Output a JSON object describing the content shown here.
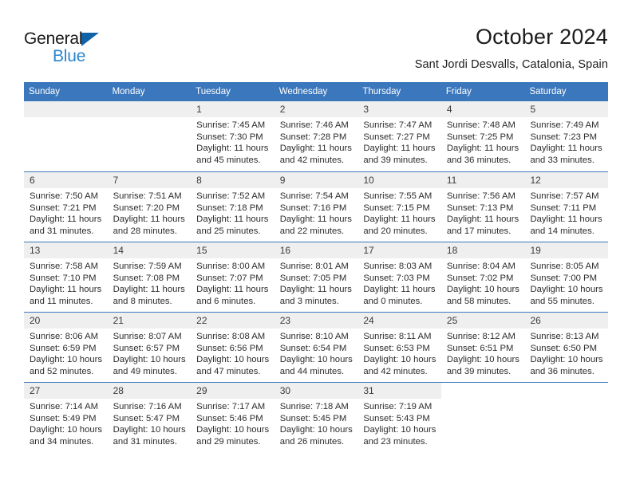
{
  "brand": {
    "name_part1": "General",
    "name_part2": "Blue",
    "triangle_color": "#1063a8",
    "blue_text_color": "#2a87d0"
  },
  "header": {
    "title": "October 2024",
    "location": "Sant Jordi Desvalls, Catalonia, Spain",
    "accent_color": "#3b77bc"
  },
  "weekdays": [
    "Sunday",
    "Monday",
    "Tuesday",
    "Wednesday",
    "Thursday",
    "Friday",
    "Saturday"
  ],
  "weeks": [
    [
      {
        "day": "",
        "state": "blank",
        "lines": []
      },
      {
        "day": "",
        "state": "blank",
        "lines": []
      },
      {
        "day": "1",
        "state": "filled",
        "lines": [
          "Sunrise: 7:45 AM",
          "Sunset: 7:30 PM",
          "Daylight: 11 hours",
          "and 45 minutes."
        ]
      },
      {
        "day": "2",
        "state": "filled",
        "lines": [
          "Sunrise: 7:46 AM",
          "Sunset: 7:28 PM",
          "Daylight: 11 hours",
          "and 42 minutes."
        ]
      },
      {
        "day": "3",
        "state": "filled",
        "lines": [
          "Sunrise: 7:47 AM",
          "Sunset: 7:27 PM",
          "Daylight: 11 hours",
          "and 39 minutes."
        ]
      },
      {
        "day": "4",
        "state": "filled",
        "lines": [
          "Sunrise: 7:48 AM",
          "Sunset: 7:25 PM",
          "Daylight: 11 hours",
          "and 36 minutes."
        ]
      },
      {
        "day": "5",
        "state": "filled",
        "lines": [
          "Sunrise: 7:49 AM",
          "Sunset: 7:23 PM",
          "Daylight: 11 hours",
          "and 33 minutes."
        ]
      }
    ],
    [
      {
        "day": "6",
        "state": "filled",
        "lines": [
          "Sunrise: 7:50 AM",
          "Sunset: 7:21 PM",
          "Daylight: 11 hours",
          "and 31 minutes."
        ]
      },
      {
        "day": "7",
        "state": "filled",
        "lines": [
          "Sunrise: 7:51 AM",
          "Sunset: 7:20 PM",
          "Daylight: 11 hours",
          "and 28 minutes."
        ]
      },
      {
        "day": "8",
        "state": "filled",
        "lines": [
          "Sunrise: 7:52 AM",
          "Sunset: 7:18 PM",
          "Daylight: 11 hours",
          "and 25 minutes."
        ]
      },
      {
        "day": "9",
        "state": "filled",
        "lines": [
          "Sunrise: 7:54 AM",
          "Sunset: 7:16 PM",
          "Daylight: 11 hours",
          "and 22 minutes."
        ]
      },
      {
        "day": "10",
        "state": "filled",
        "lines": [
          "Sunrise: 7:55 AM",
          "Sunset: 7:15 PM",
          "Daylight: 11 hours",
          "and 20 minutes."
        ]
      },
      {
        "day": "11",
        "state": "filled",
        "lines": [
          "Sunrise: 7:56 AM",
          "Sunset: 7:13 PM",
          "Daylight: 11 hours",
          "and 17 minutes."
        ]
      },
      {
        "day": "12",
        "state": "filled",
        "lines": [
          "Sunrise: 7:57 AM",
          "Sunset: 7:11 PM",
          "Daylight: 11 hours",
          "and 14 minutes."
        ]
      }
    ],
    [
      {
        "day": "13",
        "state": "filled",
        "lines": [
          "Sunrise: 7:58 AM",
          "Sunset: 7:10 PM",
          "Daylight: 11 hours",
          "and 11 minutes."
        ]
      },
      {
        "day": "14",
        "state": "filled",
        "lines": [
          "Sunrise: 7:59 AM",
          "Sunset: 7:08 PM",
          "Daylight: 11 hours",
          "and 8 minutes."
        ]
      },
      {
        "day": "15",
        "state": "filled",
        "lines": [
          "Sunrise: 8:00 AM",
          "Sunset: 7:07 PM",
          "Daylight: 11 hours",
          "and 6 minutes."
        ]
      },
      {
        "day": "16",
        "state": "filled",
        "lines": [
          "Sunrise: 8:01 AM",
          "Sunset: 7:05 PM",
          "Daylight: 11 hours",
          "and 3 minutes."
        ]
      },
      {
        "day": "17",
        "state": "filled",
        "lines": [
          "Sunrise: 8:03 AM",
          "Sunset: 7:03 PM",
          "Daylight: 11 hours",
          "and 0 minutes."
        ]
      },
      {
        "day": "18",
        "state": "filled",
        "lines": [
          "Sunrise: 8:04 AM",
          "Sunset: 7:02 PM",
          "Daylight: 10 hours",
          "and 58 minutes."
        ]
      },
      {
        "day": "19",
        "state": "filled",
        "lines": [
          "Sunrise: 8:05 AM",
          "Sunset: 7:00 PM",
          "Daylight: 10 hours",
          "and 55 minutes."
        ]
      }
    ],
    [
      {
        "day": "20",
        "state": "filled",
        "lines": [
          "Sunrise: 8:06 AM",
          "Sunset: 6:59 PM",
          "Daylight: 10 hours",
          "and 52 minutes."
        ]
      },
      {
        "day": "21",
        "state": "filled",
        "lines": [
          "Sunrise: 8:07 AM",
          "Sunset: 6:57 PM",
          "Daylight: 10 hours",
          "and 49 minutes."
        ]
      },
      {
        "day": "22",
        "state": "filled",
        "lines": [
          "Sunrise: 8:08 AM",
          "Sunset: 6:56 PM",
          "Daylight: 10 hours",
          "and 47 minutes."
        ]
      },
      {
        "day": "23",
        "state": "filled",
        "lines": [
          "Sunrise: 8:10 AM",
          "Sunset: 6:54 PM",
          "Daylight: 10 hours",
          "and 44 minutes."
        ]
      },
      {
        "day": "24",
        "state": "filled",
        "lines": [
          "Sunrise: 8:11 AM",
          "Sunset: 6:53 PM",
          "Daylight: 10 hours",
          "and 42 minutes."
        ]
      },
      {
        "day": "25",
        "state": "filled",
        "lines": [
          "Sunrise: 8:12 AM",
          "Sunset: 6:51 PM",
          "Daylight: 10 hours",
          "and 39 minutes."
        ]
      },
      {
        "day": "26",
        "state": "filled",
        "lines": [
          "Sunrise: 8:13 AM",
          "Sunset: 6:50 PM",
          "Daylight: 10 hours",
          "and 36 minutes."
        ]
      }
    ],
    [
      {
        "day": "27",
        "state": "filled",
        "lines": [
          "Sunrise: 7:14 AM",
          "Sunset: 5:49 PM",
          "Daylight: 10 hours",
          "and 34 minutes."
        ]
      },
      {
        "day": "28",
        "state": "filled",
        "lines": [
          "Sunrise: 7:16 AM",
          "Sunset: 5:47 PM",
          "Daylight: 10 hours",
          "and 31 minutes."
        ]
      },
      {
        "day": "29",
        "state": "filled",
        "lines": [
          "Sunrise: 7:17 AM",
          "Sunset: 5:46 PM",
          "Daylight: 10 hours",
          "and 29 minutes."
        ]
      },
      {
        "day": "30",
        "state": "filled",
        "lines": [
          "Sunrise: 7:18 AM",
          "Sunset: 5:45 PM",
          "Daylight: 10 hours",
          "and 26 minutes."
        ]
      },
      {
        "day": "31",
        "state": "filled",
        "lines": [
          "Sunrise: 7:19 AM",
          "Sunset: 5:43 PM",
          "Daylight: 10 hours",
          "and 23 minutes."
        ]
      },
      {
        "day": "",
        "state": "empty",
        "lines": []
      },
      {
        "day": "",
        "state": "empty",
        "lines": []
      }
    ]
  ]
}
